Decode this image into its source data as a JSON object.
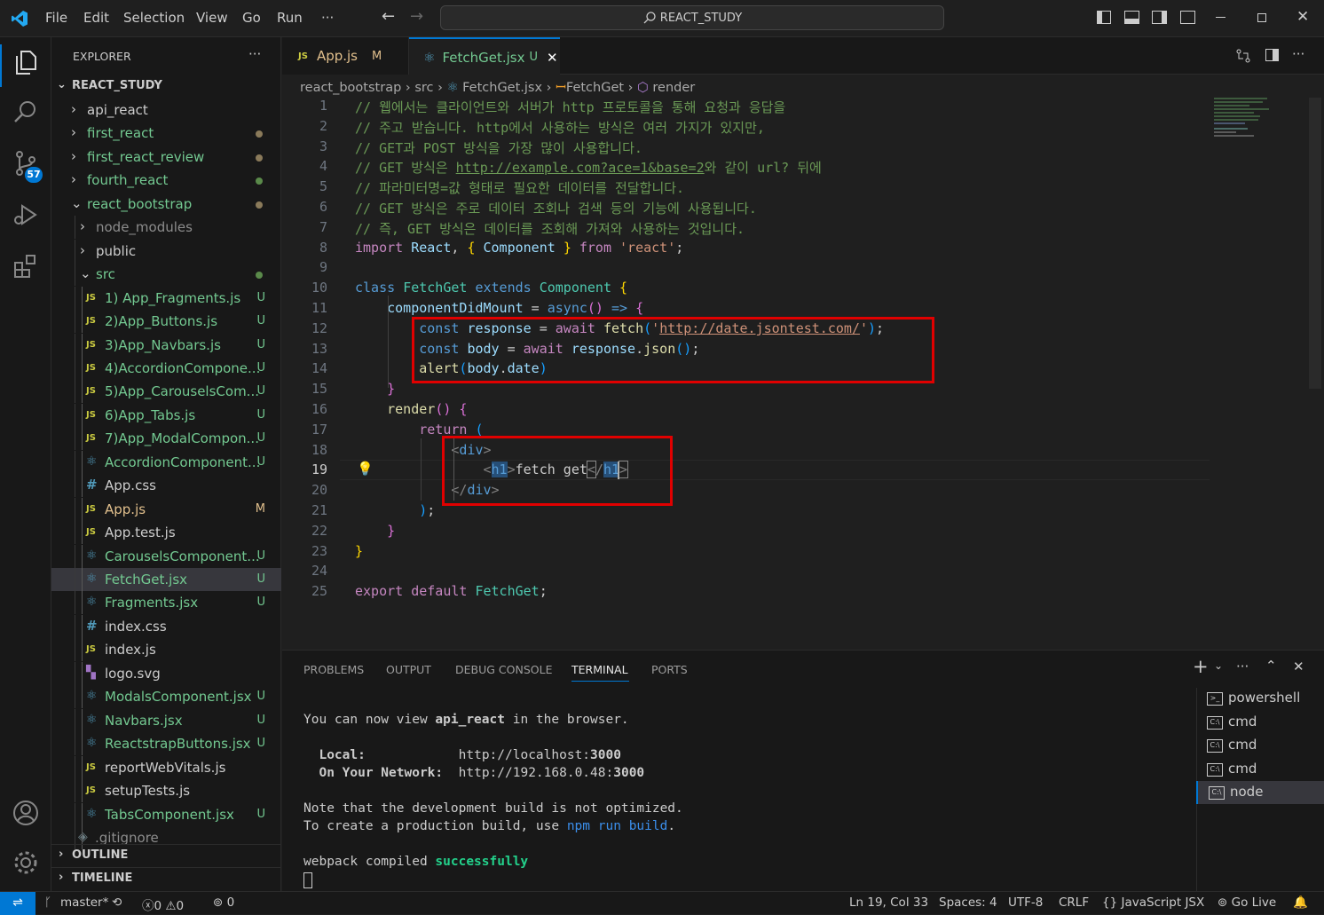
{
  "menu": {
    "file": "File",
    "edit": "Edit",
    "selection": "Selection",
    "view": "View",
    "go": "Go",
    "run": "Run",
    "more": "···",
    "search": "REACT_STUDY"
  },
  "activity": {
    "scm_badge": "57"
  },
  "explorer": {
    "title": "EXPLORER",
    "more": "···",
    "root": "REACT_STUDY",
    "items": [
      {
        "label": "api_react",
        "type": "folder",
        "status": ""
      },
      {
        "label": "first_react",
        "type": "folder",
        "status": "dot-gray"
      },
      {
        "label": "first_react_review",
        "type": "folder",
        "status": "dot-gray"
      },
      {
        "label": "fourth_react",
        "type": "folder",
        "status": "dot-green"
      },
      {
        "label": "react_bootstrap",
        "type": "folder-open",
        "status": "dot-gray"
      },
      {
        "label": "node_modules",
        "type": "folder"
      },
      {
        "label": "public",
        "type": "folder"
      },
      {
        "label": "src",
        "type": "folder-open",
        "status": "dot-green"
      },
      {
        "label": "1) App_Fragments.js",
        "icon": "JS",
        "status": "U"
      },
      {
        "label": "2)App_Buttons.js",
        "icon": "JS",
        "status": "U"
      },
      {
        "label": "3)App_Navbars.js",
        "icon": "JS",
        "status": "U"
      },
      {
        "label": "4)AccordionCompone...",
        "icon": "JS",
        "status": "U"
      },
      {
        "label": "5)App_CarouselsCom...",
        "icon": "JS",
        "status": "U"
      },
      {
        "label": "6)App_Tabs.js",
        "icon": "JS",
        "status": "U"
      },
      {
        "label": "7)App_ModalCompon...",
        "icon": "JS",
        "status": "U"
      },
      {
        "label": "AccordionComponent...",
        "icon": "react",
        "status": "U"
      },
      {
        "label": "App.css",
        "icon": "#",
        "status": ""
      },
      {
        "label": "App.js",
        "icon": "JS",
        "status": "M"
      },
      {
        "label": "App.test.js",
        "icon": "JS",
        "status": ""
      },
      {
        "label": "CarouselsComponent...",
        "icon": "react",
        "status": "U"
      },
      {
        "label": "FetchGet.jsx",
        "icon": "react",
        "status": "U"
      },
      {
        "label": "Fragments.jsx",
        "icon": "react",
        "status": "U"
      },
      {
        "label": "index.css",
        "icon": "#",
        "status": ""
      },
      {
        "label": "index.js",
        "icon": "JS",
        "status": ""
      },
      {
        "label": "logo.svg",
        "icon": "svg",
        "status": ""
      },
      {
        "label": "ModalsComponent.jsx",
        "icon": "react",
        "status": "U"
      },
      {
        "label": "Navbars.jsx",
        "icon": "react",
        "status": "U"
      },
      {
        "label": "ReactstrapButtons.jsx",
        "icon": "react",
        "status": "U"
      },
      {
        "label": "reportWebVitals.js",
        "icon": "JS",
        "status": ""
      },
      {
        "label": "setupTests.js",
        "icon": "JS",
        "status": ""
      },
      {
        "label": "TabsComponent.jsx",
        "icon": "react",
        "status": "U"
      },
      {
        "label": ".gitignore",
        "icon": "git",
        "status": ""
      }
    ],
    "outline": "OUTLINE",
    "timeline": "TIMELINE"
  },
  "tabs": [
    {
      "label": "App.js",
      "status": "M",
      "icon": "JS"
    },
    {
      "label": "FetchGet.jsx",
      "status": "U",
      "icon": "react"
    }
  ],
  "breadcrumb": {
    "a": "react_bootstrap",
    "b": "src",
    "c": "FetchGet.jsx",
    "d": "FetchGet",
    "e": "render"
  },
  "code": {
    "l1": "// 웹에서는 클라이언트와 서버가 http 프로토콜을 통해 요청과 응답을",
    "l2": "// 주고 받습니다. http에서 사용하는 방식은 여러 가지가 있지만,",
    "l3": "// GET과 POST 방식을 가장 많이 사용합니다.",
    "l4a": "// GET 방식은 ",
    "l4b": "http://example.com?ace=1&base=2",
    "l4c": "와 같이 url? 뒤에",
    "l5": "// 파라미터명=값 형태로 필요한 데이터를 전달합니다.",
    "l6": "// GET 방식은 주로 데이터 조회나 검색 등의 기능에 사용됩니다.",
    "l7": "// 즉, GET 방식은 데이터를 조회해 가져와 사용하는 것입니다.",
    "import": "import",
    "react": "React",
    "comp": "Component",
    "from": "from",
    "reactstr": "'react'",
    "class": "class",
    "fetchget": "FetchGet",
    "extends": "extends",
    "cdm": "componentDidMount",
    "async": "async",
    "const": "const",
    "response": "response",
    "await": "await",
    "fetch": "fetch",
    "url": "http://date.jsontest.com/",
    "body": "body",
    "json": "json",
    "alert": "alert",
    "date": "date",
    "render": "render",
    "return": "return",
    "div": "div",
    "h1": "h1",
    "h1text": "fetch get",
    "export": "export",
    "default": "default"
  },
  "panel": {
    "problems": "PROBLEMS",
    "output": "OUTPUT",
    "debug": "DEBUG CONSOLE",
    "terminal": "TERMINAL",
    "ports": "PORTS"
  },
  "terminal": {
    "t1a": "You can now view ",
    "t1b": "api_react",
    "t1c": " in the browser.",
    "local": "Local:",
    "local_url": "http://localhost:",
    "port": "3000",
    "network": "On Your Network:",
    "net_url": "http://192.168.0.48:",
    "note1": "Note that the development build is not optimized.",
    "note2a": "To create a production build, use ",
    "npm": "npm",
    "run": "run",
    "build": "build",
    "wp1": "webpack compiled ",
    "wp2": "successfully"
  },
  "terminals": [
    "powershell",
    "cmd",
    "cmd",
    "cmd",
    "node"
  ],
  "status": {
    "branch": "master*",
    "errors": "0",
    "warnings": "0",
    "ports": "0",
    "pos": "Ln 19, Col 33",
    "spaces": "Spaces: 4",
    "enc": "UTF-8",
    "eol": "CRLF",
    "lang": "JavaScript JSX",
    "golive": "Go Live"
  }
}
